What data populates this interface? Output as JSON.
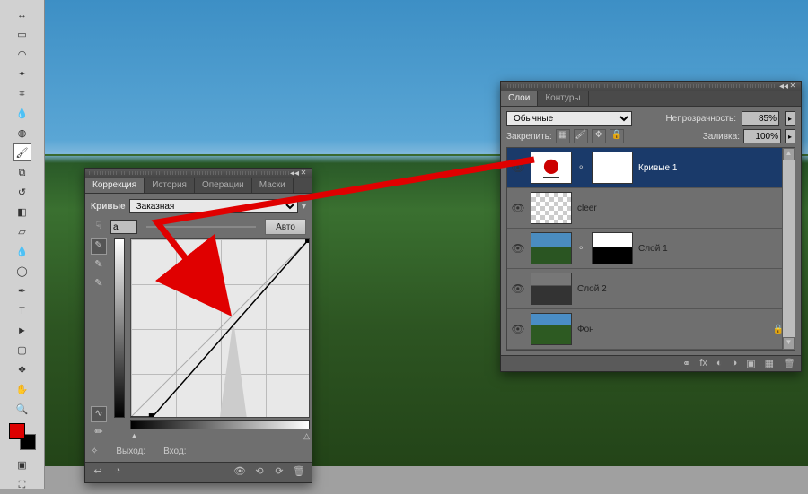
{
  "toolbox": {
    "tools": [
      {
        "name": "move-tool",
        "glyph": "↔"
      },
      {
        "name": "marquee-tool",
        "glyph": "▭"
      },
      {
        "name": "lasso-tool",
        "glyph": "◠"
      },
      {
        "name": "wand-tool",
        "glyph": "✦"
      },
      {
        "name": "crop-tool",
        "glyph": "⌗"
      },
      {
        "name": "eyedropper-tool",
        "glyph": "💧"
      },
      {
        "name": "healing-tool",
        "glyph": "◍"
      },
      {
        "name": "brush-tool",
        "glyph": "🖌",
        "active": true
      },
      {
        "name": "stamp-tool",
        "glyph": "⧉"
      },
      {
        "name": "history-brush-tool",
        "glyph": "↺"
      },
      {
        "name": "eraser-tool",
        "glyph": "◧"
      },
      {
        "name": "gradient-tool",
        "glyph": "▱"
      },
      {
        "name": "blur-tool",
        "glyph": "💧"
      },
      {
        "name": "dodge-tool",
        "glyph": "◯"
      },
      {
        "name": "pen-tool",
        "glyph": "✒"
      },
      {
        "name": "type-tool",
        "glyph": "T"
      },
      {
        "name": "path-select-tool",
        "glyph": "►"
      },
      {
        "name": "shape-tool",
        "glyph": "▢"
      },
      {
        "name": "3d-tool",
        "glyph": "❖"
      },
      {
        "name": "hand-tool",
        "glyph": "✋"
      },
      {
        "name": "zoom-tool",
        "glyph": "🔍"
      }
    ],
    "fg_color": "#d00000",
    "bg_color": "#000000"
  },
  "curves_panel": {
    "tabs": [
      "Коррекция",
      "История",
      "Операции",
      "Маски"
    ],
    "active_tab": 0,
    "title_label": "Кривые",
    "preset_label": "Заказная",
    "channel_value": "a",
    "auto_label": "Авто",
    "output_label": "Выход:",
    "input_label": "Вход:"
  },
  "layers_panel": {
    "tabs": [
      "Слои",
      "Контуры"
    ],
    "active_tab": 0,
    "blend_mode": "Обычные",
    "opacity_label": "Непрозрачность:",
    "opacity_value": "85%",
    "lock_label": "Закрепить:",
    "fill_label": "Заливка:",
    "fill_value": "100%",
    "layers": [
      {
        "name": "Кривые 1",
        "visible": true,
        "type": "curves",
        "selected": true,
        "has_mask": true
      },
      {
        "name": "cleer",
        "visible": true,
        "type": "checker",
        "has_mask": false
      },
      {
        "name": "Слой 1",
        "visible": true,
        "type": "sky",
        "has_mask": true
      },
      {
        "name": "Слой 2",
        "visible": true,
        "type": "bw",
        "has_mask": false
      },
      {
        "name": "Фон",
        "visible": true,
        "type": "grass",
        "has_mask": false,
        "locked": true
      }
    ]
  },
  "chart_data": {
    "type": "line",
    "title": "",
    "xlabel": "Вход",
    "ylabel": "Выход",
    "xlim": [
      0,
      255
    ],
    "ylim": [
      0,
      255
    ],
    "series": [
      {
        "name": "curve",
        "x": [
          0,
          30,
          255
        ],
        "y": [
          0,
          0,
          255
        ]
      },
      {
        "name": "baseline",
        "x": [
          0,
          255
        ],
        "y": [
          0,
          255
        ]
      }
    ],
    "histogram_peak_x": 128
  }
}
